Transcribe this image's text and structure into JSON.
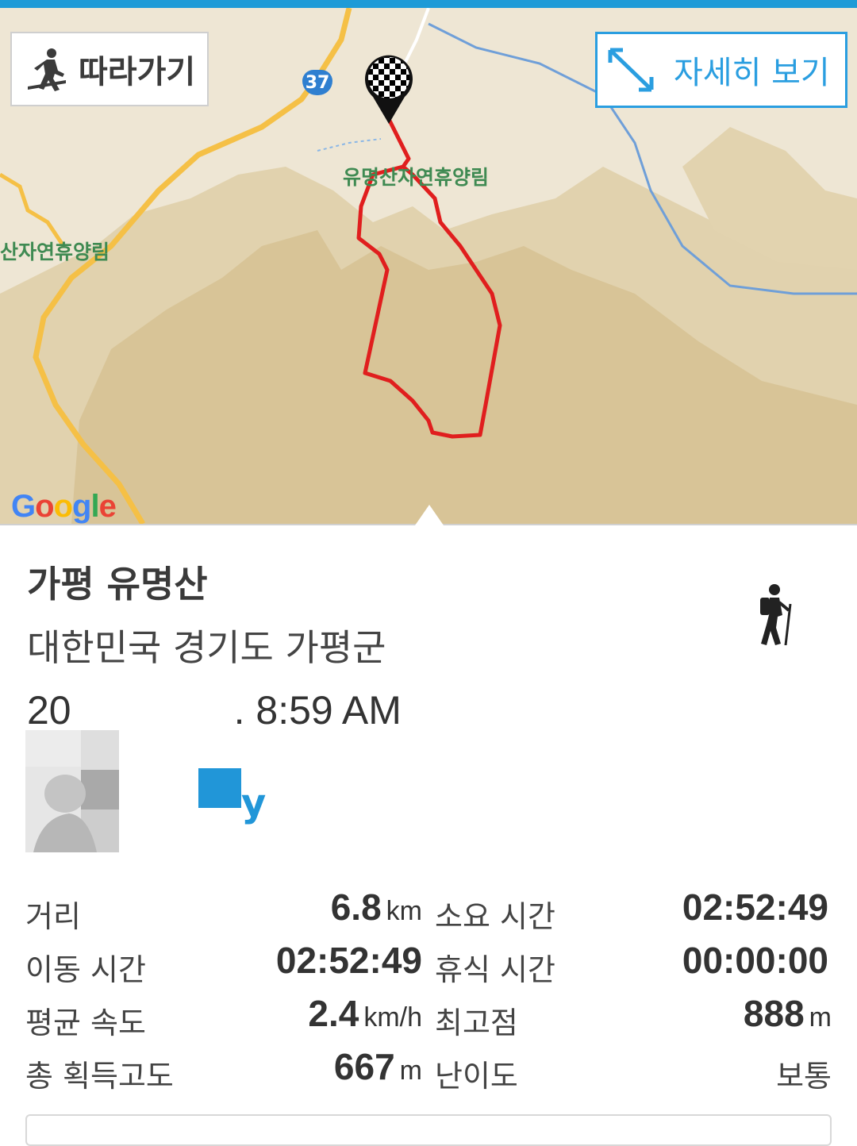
{
  "map": {
    "follow_label": "따라가기",
    "detail_label": "자세히 보기",
    "road_number": "37",
    "place_label_1": "유명산자연휴양림",
    "place_label_2": "산자연휴양림",
    "provider": "Google",
    "route_color": "#e01e1e",
    "accent_color": "#2a9ee0"
  },
  "activity": {
    "title": "가평 유명산",
    "location": "대한민국 경기도 가평군",
    "datetime_prefix": "20",
    "datetime_suffix": ". 8:59 AM",
    "type_icon": "hiking-icon",
    "user_name_tail": "y"
  },
  "stats": {
    "distance_label": "거리",
    "distance_value": "6.8",
    "distance_unit": "km",
    "duration_label": "소요 시간",
    "duration_value": "02:52:49",
    "moving_label": "이동 시간",
    "moving_value": "02:52:49",
    "rest_label": "휴식 시간",
    "rest_value": "00:00:00",
    "speed_label": "평균 속도",
    "speed_value": "2.4",
    "speed_unit": "km/h",
    "max_alt_label": "최고점",
    "max_alt_value": "888",
    "max_alt_unit": "m",
    "gain_label": "총 획득고도",
    "gain_value": "667",
    "gain_unit": "m",
    "difficulty_label": "난이도",
    "difficulty_value": "보통"
  }
}
